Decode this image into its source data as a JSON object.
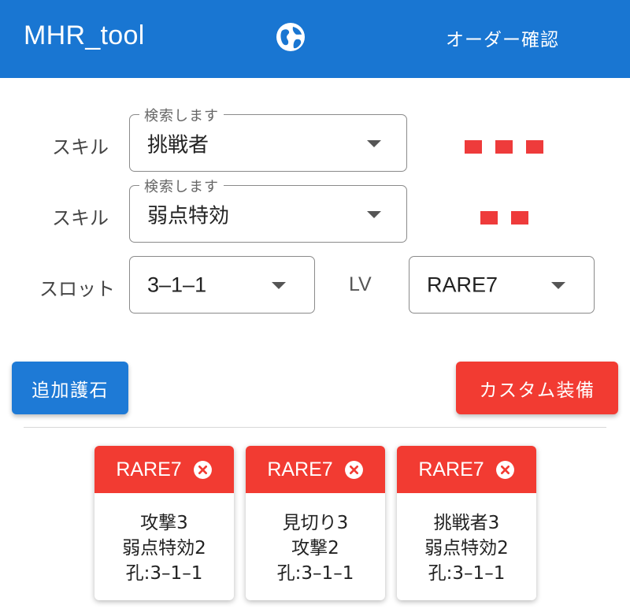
{
  "appbar": {
    "title": "MHR_tool",
    "language_icon": "globe-icon",
    "order_confirm_label": "オーダー確認"
  },
  "form": {
    "skill1": {
      "label": "スキル",
      "legend": "検索します",
      "value": "挑戦者",
      "level_shown": 3
    },
    "skill2": {
      "label": "スキル",
      "legend": "検索します",
      "value": "弱点特効",
      "level_shown": 2
    },
    "slot": {
      "label": "スロット",
      "value": "3–1–1"
    },
    "lv": {
      "label": "LV",
      "value": "RARE7"
    }
  },
  "buttons": {
    "add": "追加護石",
    "custom": "カスタム装備"
  },
  "cards": [
    {
      "rarity": "RARE7",
      "lines": [
        "攻撃3",
        "弱点特効2",
        "孔:3–1–1"
      ]
    },
    {
      "rarity": "RARE7",
      "lines": [
        "見切り3",
        "攻撃2",
        "孔:3–1–1"
      ]
    },
    {
      "rarity": "RARE7",
      "lines": [
        "挑戦者3",
        "弱点特効2",
        "孔:3–1–1"
      ]
    }
  ],
  "colors": {
    "primary": "#1976d2",
    "accent": "#f23b32",
    "level_dot": "#ee3b3b"
  }
}
